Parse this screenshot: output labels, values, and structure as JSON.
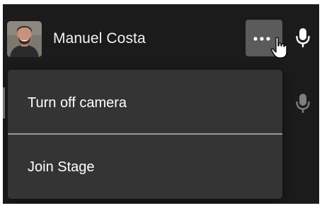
{
  "participant": {
    "name": "Manuel Costa",
    "avatar": "avatar-photo"
  },
  "toolbar": {
    "more_icon": "ellipsis-icon",
    "mic_icon": "microphone-icon"
  },
  "menu": {
    "items": [
      {
        "label": "Turn off camera"
      },
      {
        "label": "Join Stage"
      }
    ]
  },
  "colors": {
    "panel_bg": "#1b1b1b",
    "menu_bg": "#343434",
    "button_bg": "#5b5b5b",
    "text": "#f2f2f2"
  }
}
